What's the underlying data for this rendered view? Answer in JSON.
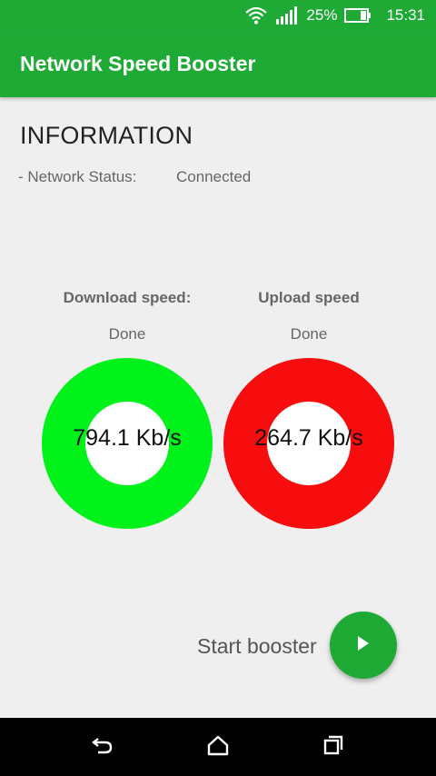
{
  "status_bar": {
    "battery": "25%",
    "time": "15:31",
    "icons": [
      "wifi-icon",
      "signal-icon",
      "battery-icon"
    ]
  },
  "app_bar": {
    "title": "Network Speed Booster"
  },
  "info": {
    "heading": "INFORMATION",
    "network_status_label": "- Network Status:",
    "network_status_value": "Connected"
  },
  "download": {
    "title": "Download speed:",
    "state": "Done",
    "value": "794.1 Kb/s",
    "color": "#00f21a"
  },
  "upload": {
    "title": "Upload speed",
    "state": "Done",
    "value": "264.7 Kb/s",
    "color": "#f70d0d"
  },
  "booster": {
    "label": "Start booster",
    "icon": "play-icon",
    "color": "#1faa35"
  },
  "nav": {
    "icons": [
      "back-icon",
      "home-icon",
      "recents-icon"
    ]
  }
}
